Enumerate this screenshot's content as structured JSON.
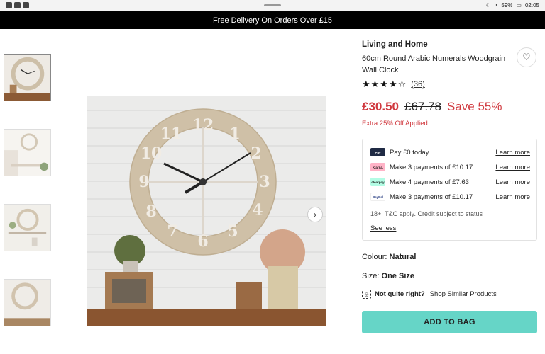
{
  "statusbar": {
    "battery": "59%",
    "time": "02:05"
  },
  "banner": {
    "text": "Free Delivery On Orders Over £15"
  },
  "product": {
    "brand": "Living and Home",
    "title": "60cm Round Arabic Numerals Woodgrain Wall Clock",
    "stars": "★★★★☆",
    "rating_value": 4,
    "review_count": "(36)",
    "price_now": "£30.50",
    "price_was": "£67.78",
    "save": "Save 55%",
    "promo": "Extra 25% Off Applied"
  },
  "payment": {
    "options": [
      {
        "logo": "Pay",
        "text": "Pay £0 today",
        "link": "Learn more"
      },
      {
        "logo": "Klarna.",
        "text": "Make 3 payments of £10.17",
        "link": "Learn more"
      },
      {
        "logo": "clearpay",
        "text": "Make 4 payments of £7.63",
        "link": "Learn more"
      },
      {
        "logo": "PayPal",
        "text": "Make 3 payments of £10.17",
        "link": "Learn more"
      }
    ],
    "note": "18+, T&C apply. Credit subject to status",
    "see_less": "See less"
  },
  "selection": {
    "colour_label": "Colour:",
    "colour_value": "Natural",
    "size_label": "Size:",
    "size_value": "One Size",
    "not_quite": "Not quite right?",
    "similar_link": "Shop Similar Products"
  },
  "cta": {
    "add_to_bag": "ADD TO BAG"
  },
  "icons": {
    "wishlist": "heart-icon",
    "next": "chevron-right-icon",
    "search": "visual-search-icon"
  },
  "colors": {
    "sale": "#d0383e",
    "cta": "#66d5c7",
    "banner": "#000000"
  }
}
